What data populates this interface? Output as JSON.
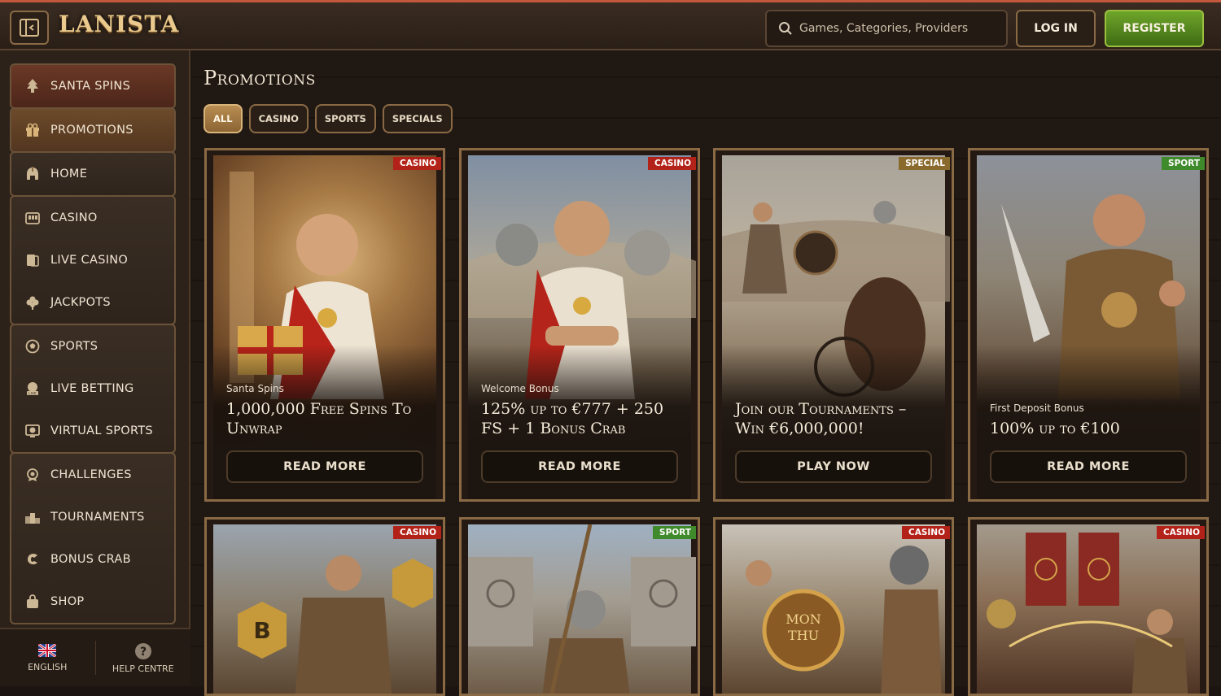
{
  "header": {
    "logo": "LANISTA",
    "search_placeholder": "Games, Categories, Providers",
    "login_label": "LOG IN",
    "register_label": "REGISTER"
  },
  "sidebar": {
    "items": [
      {
        "label": "SANTA SPINS",
        "icon": "tree-icon"
      },
      {
        "label": "PROMOTIONS",
        "icon": "gift-icon"
      },
      {
        "label": "HOME",
        "icon": "helmet-icon"
      },
      {
        "label": "CASINO",
        "icon": "slot-machine-icon"
      },
      {
        "label": "LIVE CASINO",
        "icon": "live-cards-icon"
      },
      {
        "label": "JACKPOTS",
        "icon": "clover-icon"
      },
      {
        "label": "SPORTS",
        "icon": "ball-icon"
      },
      {
        "label": "LIVE BETTING",
        "icon": "live-tv-icon"
      },
      {
        "label": "VIRTUAL SPORTS",
        "icon": "virtual-ball-icon"
      },
      {
        "label": "CHALLENGES",
        "icon": "medal-icon"
      },
      {
        "label": "TOURNAMENTS",
        "icon": "podium-icon"
      },
      {
        "label": "BONUS CRAB",
        "icon": "crab-icon"
      },
      {
        "label": "SHOP",
        "icon": "bag-icon"
      }
    ],
    "footer": {
      "language": "ENGLISH",
      "help": "HELP CENTRE"
    }
  },
  "main": {
    "title": "Promotions",
    "filters": [
      "ALL",
      "CASINO",
      "SPORTS",
      "SPECIALS"
    ],
    "cards": [
      {
        "tag": "CASINO",
        "subtitle": "Santa Spins",
        "title": "1,000,000 Free Spins To Unwrap",
        "button": "READ MORE"
      },
      {
        "tag": "CASINO",
        "subtitle": "Welcome Bonus",
        "title": "125% up to €777 + 250 FS + 1 Bonus Crab",
        "button": "READ MORE"
      },
      {
        "tag": "SPECIAL",
        "subtitle": "",
        "title": "Join our Tournaments – Win €6,000,000!",
        "button": "PLAY NOW"
      },
      {
        "tag": "SPORT",
        "subtitle": "First Deposit Bonus",
        "title": "100% up to €100",
        "button": "READ MORE"
      },
      {
        "tag": "CASINO"
      },
      {
        "tag": "SPORT"
      },
      {
        "tag": "CASINO",
        "shield_text": "MON THU"
      },
      {
        "tag": "CASINO"
      }
    ]
  },
  "colors": {
    "accent_red": "#c4583c",
    "register_green": "#5a8f22",
    "gold_border": "#8a6a45",
    "tag_casino": "#b32218",
    "tag_sport": "#3f8a2a",
    "tag_special": "#8a6a2c"
  }
}
